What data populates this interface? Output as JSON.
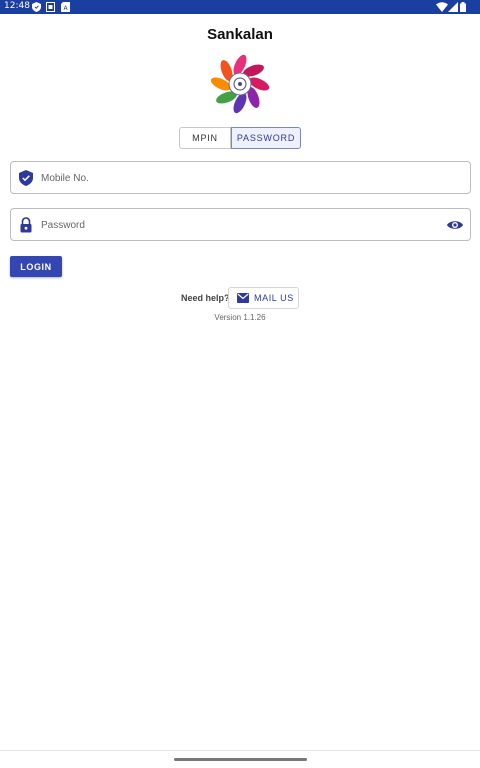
{
  "status_bar": {
    "time": "12:48"
  },
  "app": {
    "title": "Sankalan"
  },
  "login_mode": {
    "options": [
      "MPIN",
      "PASSWORD"
    ],
    "selected": "PASSWORD"
  },
  "form": {
    "mobile_placeholder": "Mobile No.",
    "mobile_value": "",
    "password_placeholder": "Password",
    "password_value": "",
    "login_label": "LOGIN"
  },
  "help": {
    "need_help": "Need help?",
    "mail_label": "MAIL US"
  },
  "footer": {
    "version": "Version 1.1.26"
  },
  "colors": {
    "status_bar": "#1a3fa0",
    "accent": "#3446b2",
    "icon": "#2d3a9b"
  }
}
